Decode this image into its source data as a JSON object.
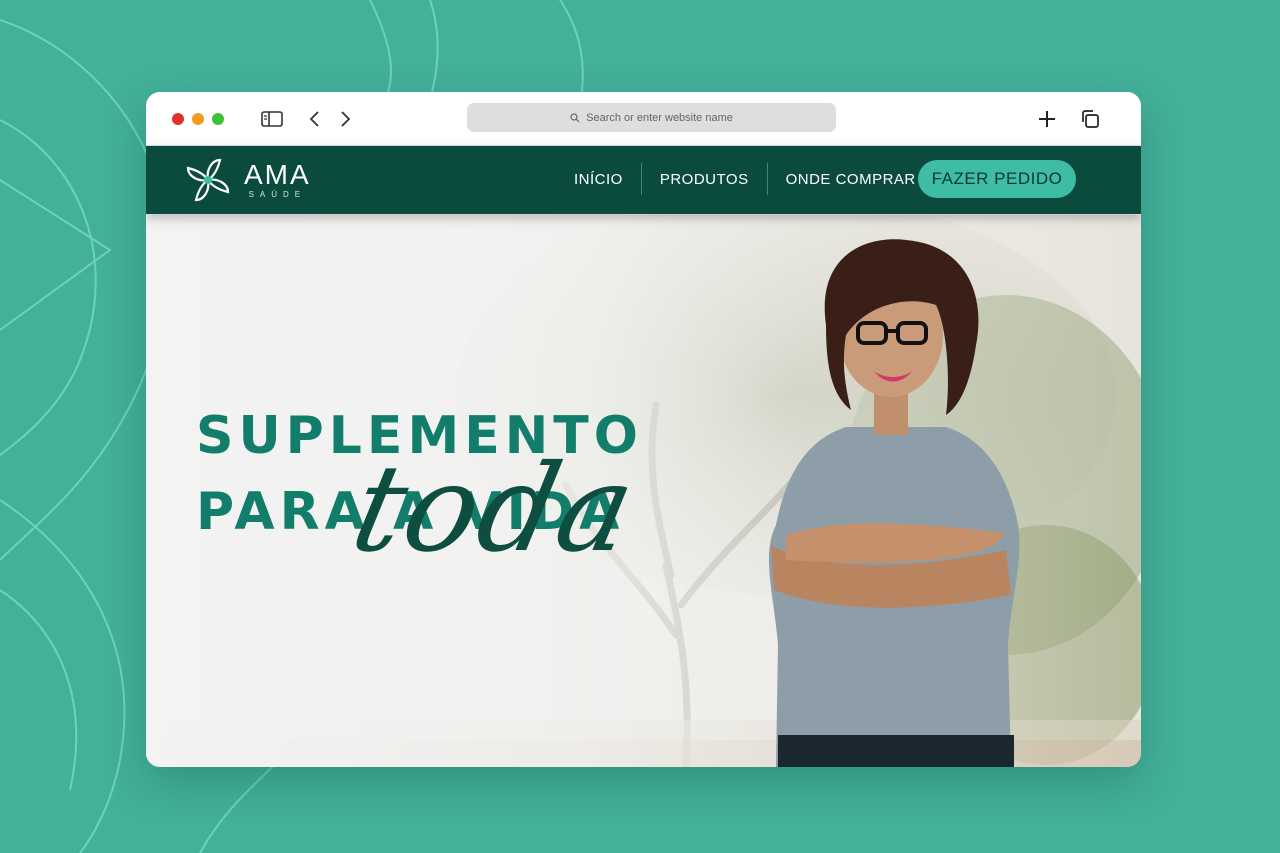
{
  "browser": {
    "address_placeholder": "Search or enter website name"
  },
  "navbar": {
    "logo_name": "AMA",
    "logo_sub": "SAÚDE",
    "links": [
      "INÍCIO",
      "PRODUTOS",
      "ONDE COMPRAR"
    ],
    "cta_label": "FAZER PEDIDO"
  },
  "hero": {
    "headline_line1": "SUPLEMENTO",
    "headline_line2": "PARA A VIDA",
    "script_word": "toda"
  },
  "colors": {
    "page_bg": "#43b09a",
    "navbar_bg": "#0a4b3d",
    "cta_bg": "#3fbca4",
    "headline": "#127d6a",
    "script": "#0d4e40"
  }
}
